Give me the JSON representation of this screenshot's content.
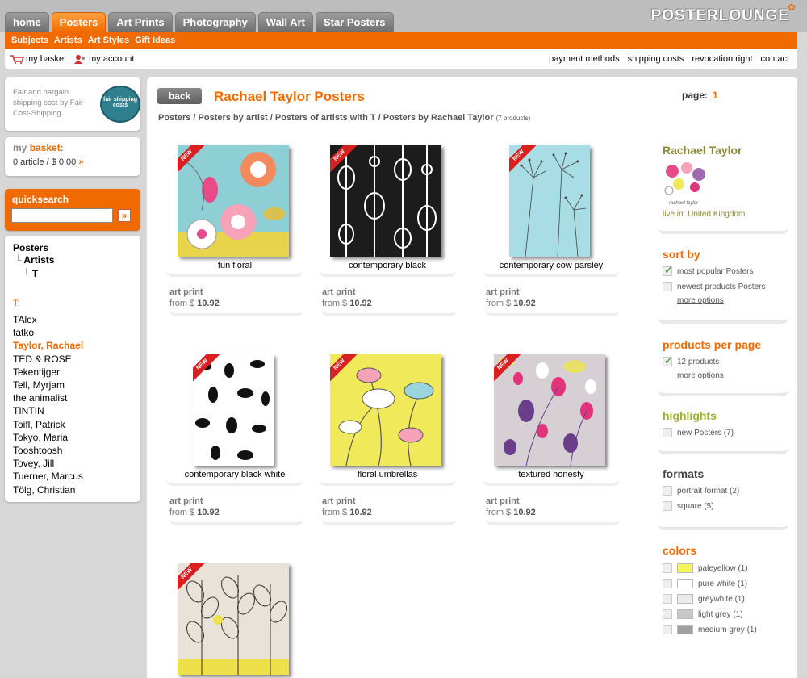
{
  "tabs": [
    "home",
    "Posters",
    "Art Prints",
    "Photography",
    "Wall Art",
    "Star Posters"
  ],
  "active_tab": 1,
  "logo": "POSTERLOUNGE",
  "subnav": [
    "Subjects",
    "Artists",
    "Art Styles",
    "Gift Ideas"
  ],
  "util_left": [
    "my basket",
    "my account"
  ],
  "util_right": [
    "payment methods",
    "shipping costs",
    "revocation right",
    "contact"
  ],
  "shipping": {
    "text": "Fair and bargain shipping cost by Fair-Cost-Shipping",
    "badge": "fair shipping costs"
  },
  "basket": {
    "my": "my",
    "title": "basket",
    "value": "0 article / $ 0.00"
  },
  "quicksearch": {
    "title": "quicksearch",
    "placeholder": ""
  },
  "tree": {
    "root": "Posters",
    "child": "Artists",
    "leaf": "T"
  },
  "alpha_label": "T:",
  "artists": [
    "TAlex",
    "tatko",
    "Taylor, Rachael",
    "TED & ROSE",
    "Tekentijger",
    "Tell, Myrjam",
    "the animalist",
    "TINTIN",
    "Toifl, Patrick",
    "Tokyo, Maria",
    "Tooshtoosh",
    "Tovey, Jill",
    "Tuerner, Marcus",
    "Tölg, Christian"
  ],
  "selected_artist": 2,
  "main": {
    "back": "back",
    "title": "Rachael Taylor Posters",
    "page_label": "page:",
    "page_num": "1",
    "breadcrumb": "Posters / Posters by artist / Posters of artists with T / Posters by Rachael Taylor",
    "count": "(7 products)"
  },
  "products": [
    {
      "name": "fun floral",
      "type": "art print",
      "price_from": "from $",
      "price": "10.92",
      "badge": "NEW"
    },
    {
      "name": "contemporary black",
      "type": "art print",
      "price_from": "from $",
      "price": "10.92",
      "badge": "NEW"
    },
    {
      "name": "contemporary cow parsley",
      "type": "art print",
      "price_from": "from $",
      "price": "10.92",
      "badge": "NEW"
    },
    {
      "name": "contemporary black white",
      "type": "art print",
      "price_from": "from $",
      "price": "10.92",
      "badge": "NEW"
    },
    {
      "name": "floral umbrellas",
      "type": "art print",
      "price_from": "from $",
      "price": "10.92",
      "badge": "NEW"
    },
    {
      "name": "textured honesty",
      "type": "art print",
      "price_from": "from $",
      "price": "10.92",
      "badge": "NEW"
    },
    {
      "name": "",
      "type": "",
      "price_from": "",
      "price": "",
      "badge": "NEW"
    }
  ],
  "artist_box": {
    "name": "Rachael Taylor",
    "live": "live in: United Kingdom",
    "signature": "rachael taylor"
  },
  "sort": {
    "title": "sort by",
    "options": [
      "most popular Posters",
      "newest products Posters"
    ],
    "more": "more options"
  },
  "per_page": {
    "title": "products per page",
    "option": "12 products",
    "more": "more options"
  },
  "highlights": {
    "title": "highlights",
    "option": "new Posters (7)"
  },
  "formats": {
    "title": "formats",
    "options": [
      "portrait format (2)",
      "square (5)"
    ]
  },
  "colors": {
    "title": "colors",
    "options": [
      {
        "label": "paleyellow (1)",
        "hex": "#f5f55a"
      },
      {
        "label": "pure white (1)",
        "hex": "#ffffff"
      },
      {
        "label": "greywhite (1)",
        "hex": "#ebebeb"
      },
      {
        "label": "light grey (1)",
        "hex": "#c8c8c8"
      },
      {
        "label": "medium grey (1)",
        "hex": "#a0a0a0"
      }
    ]
  }
}
